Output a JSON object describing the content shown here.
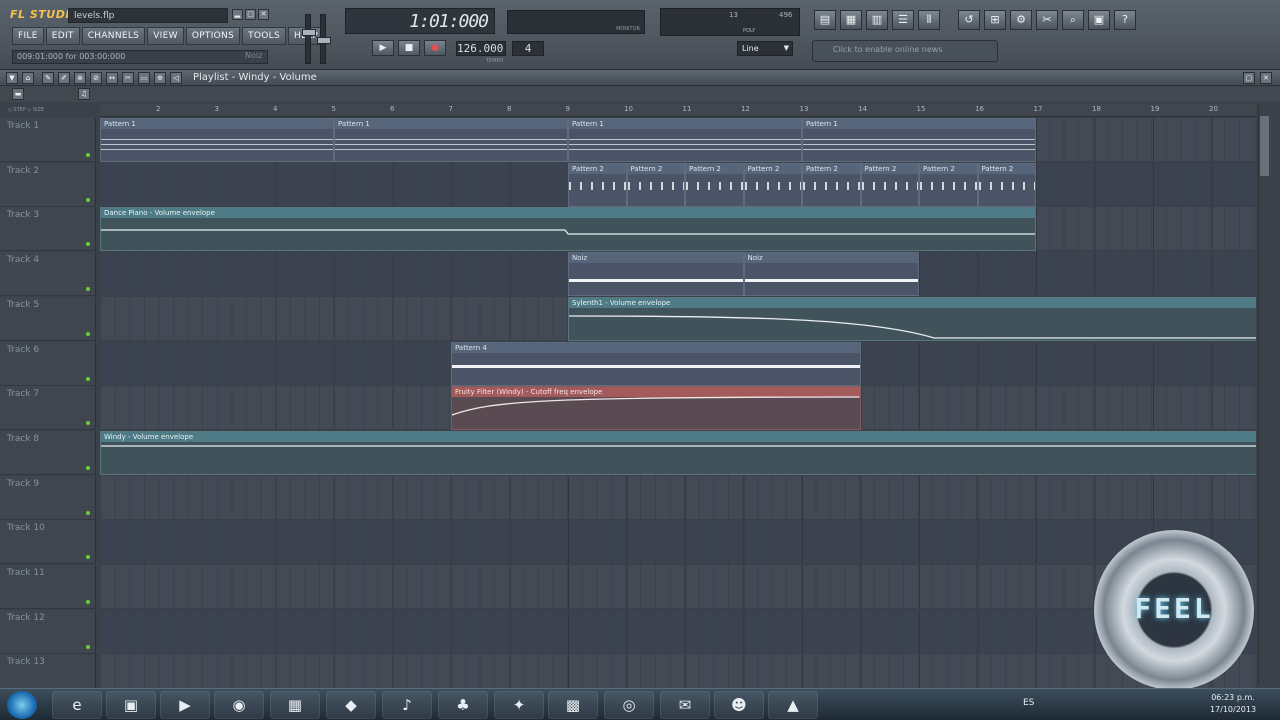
{
  "app": {
    "logo": "FL STUDIO",
    "filename": "levels.flp"
  },
  "menu": [
    "FILE",
    "EDIT",
    "CHANNELS",
    "VIEW",
    "OPTIONS",
    "TOOLS",
    "HELP"
  ],
  "hint": {
    "text": "009:01:000 for 003:00:000",
    "right": "Noiz"
  },
  "transport": {
    "time": "1:01:000",
    "tempo": "126.000",
    "tempo_label": "TEMPO",
    "pattern": "4",
    "snap": "Line",
    "play": "▶",
    "stop": "■",
    "rec": "●"
  },
  "monitor": {
    "label": "MONITOR"
  },
  "meter": {
    "cpu": "13",
    "ram": "496",
    "poly": "POLY"
  },
  "news": {
    "text": "Click to enable online news"
  },
  "toolbar_icons": [
    "playlist-icon",
    "step-sequencer-icon",
    "piano-roll-icon",
    "browser-icon",
    "mixer-icon",
    "undo-icon",
    "project-icon",
    "plugin-icon",
    "cut-icon",
    "search-icon",
    "save-icon",
    "help-icon"
  ],
  "playlist": {
    "title": "Playlist - Windy - Volume",
    "ruler_ticks": [
      "2",
      "3",
      "4",
      "5",
      "6",
      "7",
      "8",
      "9",
      "10",
      "11",
      "12",
      "13",
      "14",
      "15",
      "16",
      "17",
      "18",
      "19",
      "20"
    ],
    "tracks": [
      "Track 1",
      "Track 2",
      "Track 3",
      "Track 4",
      "Track 5",
      "Track 6",
      "Track 7",
      "Track 8",
      "Track 9",
      "Track 10",
      "Track 11",
      "Track 12",
      "Track 13"
    ],
    "clip_labels": {
      "pattern1": "Pattern 1",
      "pattern2": "Pattern 2",
      "dance_piano": "Dance Piano - Volume envelope",
      "noiz": "Noiz",
      "sylenth": "Sylenth1 - Volume envelope",
      "pattern4": "Pattern 4",
      "fruity_filter": "Fruity Filter (Windy) - Cutoff freq envelope",
      "windy": "Windy - Volume envelope"
    }
  },
  "taskbar": {
    "lang": "ES",
    "time": "06:23 p.m.",
    "date": "17/10/2013"
  },
  "logo_text": "FEEL"
}
